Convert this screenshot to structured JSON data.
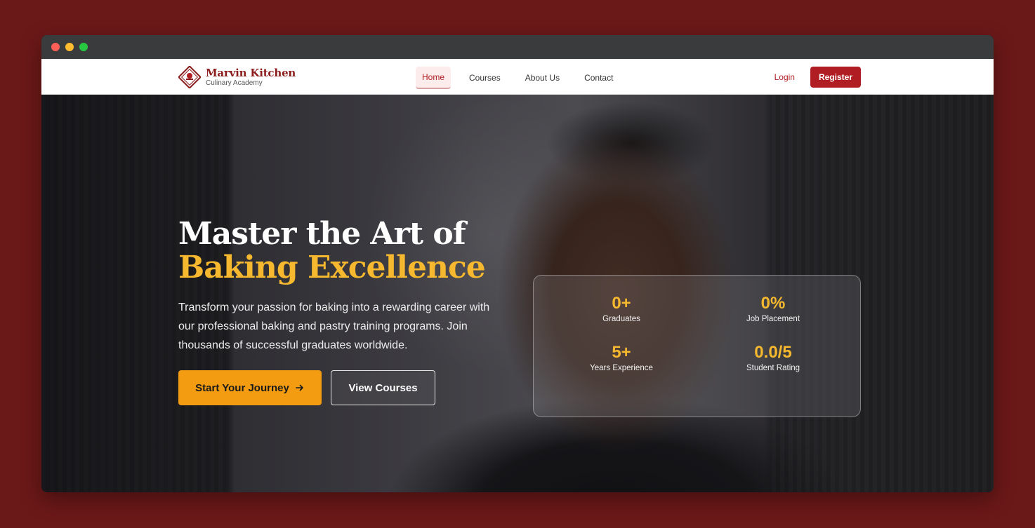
{
  "brand": {
    "name": "Marvin Kitchen",
    "subtitle": "Culinary Academy"
  },
  "nav": {
    "links": [
      "Home",
      "Courses",
      "About Us",
      "Contact"
    ],
    "active": "Home",
    "login_label": "Login",
    "register_label": "Register"
  },
  "hero": {
    "title_line1": "Master the Art of",
    "title_line2": "Baking Excellence",
    "description": "Transform your passion for baking into a rewarding career with our professional baking and pastry training programs. Join thousands of successful graduates worldwide.",
    "primary_button": "Start Your Journey",
    "secondary_button": "View Courses"
  },
  "stats": [
    {
      "value": "0+",
      "label": "Graduates"
    },
    {
      "value": "0%",
      "label": "Job Placement"
    },
    {
      "value": "5+",
      "label": "Years Experience"
    },
    {
      "value": "0.0/5",
      "label": "Student Rating"
    }
  ],
  "colors": {
    "page_background": "#6b1818",
    "brand_red": "#b01e23",
    "accent_gold": "#f5b82e",
    "primary_button": "#f39c12"
  },
  "icons": {
    "logo": "chef-badge-icon",
    "primary_button_icon": "arrow-right-icon"
  }
}
